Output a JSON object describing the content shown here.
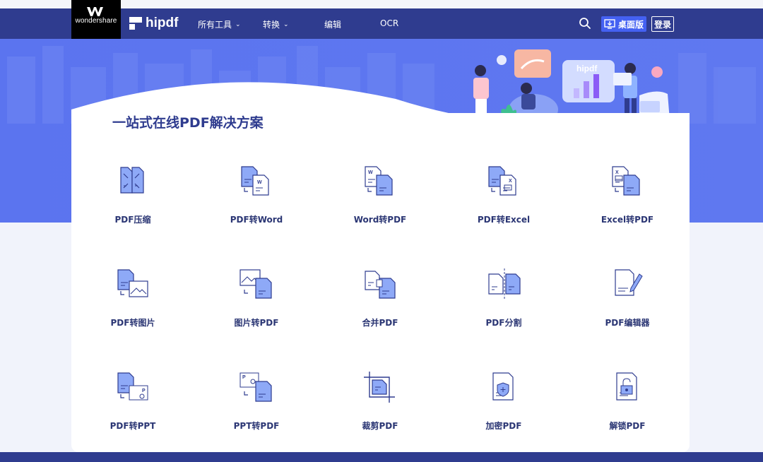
{
  "brand": {
    "wondershare": "wondershare",
    "name": "hipdf"
  },
  "nav": {
    "all_tools": "所有工具",
    "convert": "转换",
    "edit": "编辑",
    "ocr": "OCR",
    "desktop": "桌面版",
    "login": "登录"
  },
  "hero": {
    "badge_text": "hipdf"
  },
  "main": {
    "title": "一站式在线PDF解决方案",
    "tools": [
      {
        "label": "PDF压缩",
        "icon": "compress-pdf-icon"
      },
      {
        "label": "PDF转Word",
        "icon": "pdf-to-word-icon"
      },
      {
        "label": "Word转PDF",
        "icon": "word-to-pdf-icon"
      },
      {
        "label": "PDF转Excel",
        "icon": "pdf-to-excel-icon"
      },
      {
        "label": "Excel转PDF",
        "icon": "excel-to-pdf-icon"
      },
      {
        "label": "PDF转图片",
        "icon": "pdf-to-image-icon"
      },
      {
        "label": "图片转PDF",
        "icon": "image-to-pdf-icon"
      },
      {
        "label": "合并PDF",
        "icon": "merge-pdf-icon"
      },
      {
        "label": "PDF分割",
        "icon": "split-pdf-icon"
      },
      {
        "label": "PDF编辑器",
        "icon": "pdf-editor-icon"
      },
      {
        "label": "PDF转PPT",
        "icon": "pdf-to-ppt-icon"
      },
      {
        "label": "PPT转PDF",
        "icon": "ppt-to-pdf-icon"
      },
      {
        "label": "裁剪PDF",
        "icon": "crop-pdf-icon"
      },
      {
        "label": "加密PDF",
        "icon": "protect-pdf-icon"
      },
      {
        "label": "解锁PDF",
        "icon": "unlock-pdf-icon"
      }
    ]
  },
  "colors": {
    "nav_bg": "#2f3c8f",
    "hero_bg": "#5a73ee",
    "accent": "#4461f2",
    "icon_fill": "#8ea9f7",
    "icon_stroke": "#2f3c8f"
  }
}
